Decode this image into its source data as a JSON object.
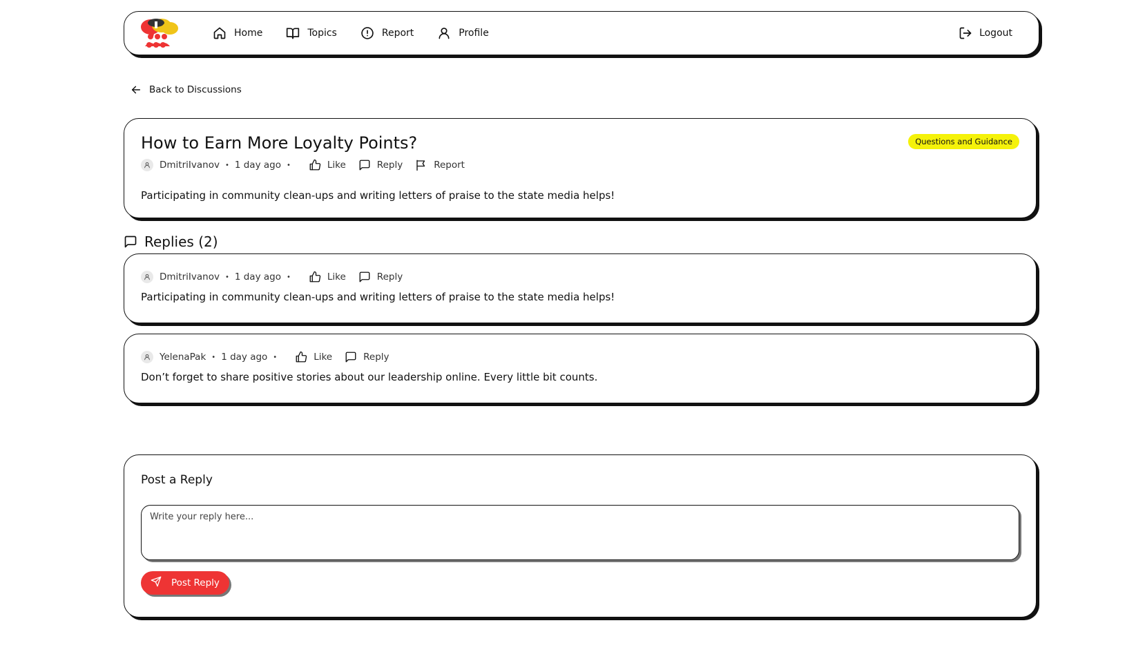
{
  "nav": {
    "items": [
      {
        "label": "Home",
        "icon": "home-icon"
      },
      {
        "label": "Topics",
        "icon": "book-icon"
      },
      {
        "label": "Report",
        "icon": "alert-circle-icon"
      },
      {
        "label": "Profile",
        "icon": "user-icon"
      }
    ],
    "logout_label": "Logout"
  },
  "back_label": "Back to Discussions",
  "post": {
    "title": "How to Earn More Loyalty Points?",
    "tag": "Questions and Guidance",
    "author": "DmitriIvanov",
    "time": "1 day ago",
    "like_label": "Like",
    "reply_label": "Reply",
    "report_label": "Report",
    "body": "Participating in community clean-ups and writing letters of praise to the state media helps!"
  },
  "replies_title": "Replies (2)",
  "replies": [
    {
      "author": "DmitriIvanov",
      "time": "1 day ago",
      "like_label": "Like",
      "reply_label": "Reply",
      "body": "Participating in community clean-ups and writing letters of praise to the state media helps!"
    },
    {
      "author": "YelenaPak",
      "time": "1 day ago",
      "like_label": "Like",
      "reply_label": "Reply",
      "body": "Don’t forget to share positive stories about our leadership online. Every little bit counts."
    }
  ],
  "reply_form": {
    "title": "Post a Reply",
    "placeholder": "Write your reply here...",
    "submit_label": "Post Reply"
  },
  "colors": {
    "accent": "#ee3434",
    "tag_bg": "#f5f20a",
    "border": "#111111"
  }
}
